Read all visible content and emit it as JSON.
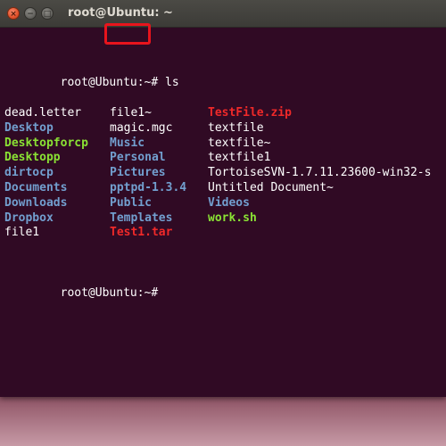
{
  "window": {
    "title": "root@Ubuntu: ~",
    "close_glyph": "×",
    "minimize_glyph": "−",
    "maximize_glyph": "□"
  },
  "colors": {
    "background": "#300a24",
    "text": "#ffffff",
    "directory": "#729fcf",
    "executable": "#8ae234",
    "archive": "#ef2929",
    "highlight_box": "#e8141c"
  },
  "terminal": {
    "prompt": "root@Ubuntu:~# ",
    "command": "ls",
    "final_prompt": "root@Ubuntu:~# ",
    "rows": [
      [
        {
          "text": "dead.letter",
          "type": "file"
        },
        {
          "text": "file1~",
          "type": "file"
        },
        {
          "text": "TestFile.zip",
          "type": "archive"
        }
      ],
      [
        {
          "text": "Desktop",
          "type": "directory"
        },
        {
          "text": "magic.mgc",
          "type": "file"
        },
        {
          "text": "textfile",
          "type": "file"
        }
      ],
      [
        {
          "text": "Desktopforcp",
          "type": "executable"
        },
        {
          "text": "Music",
          "type": "directory"
        },
        {
          "text": "textfile~",
          "type": "file"
        }
      ],
      [
        {
          "text": "Desktopp",
          "type": "executable"
        },
        {
          "text": "Personal",
          "type": "directory"
        },
        {
          "text": "textfile1",
          "type": "file"
        }
      ],
      [
        {
          "text": "dirtocp",
          "type": "directory"
        },
        {
          "text": "Pictures",
          "type": "directory"
        },
        {
          "text": "TortoiseSVN-1.7.11.23600-win32-s",
          "type": "file"
        }
      ],
      [
        {
          "text": "Documents",
          "type": "directory"
        },
        {
          "text": "pptpd-1.3.4",
          "type": "directory"
        },
        {
          "text": "Untitled Document~",
          "type": "file"
        }
      ],
      [
        {
          "text": "Downloads",
          "type": "directory"
        },
        {
          "text": "Public",
          "type": "directory"
        },
        {
          "text": "Videos",
          "type": "directory"
        }
      ],
      [
        {
          "text": "Dropbox",
          "type": "directory"
        },
        {
          "text": "Templates",
          "type": "directory"
        },
        {
          "text": "work.sh",
          "type": "executable"
        }
      ],
      [
        {
          "text": "file1",
          "type": "file"
        },
        {
          "text": "Test1.tar",
          "type": "archive"
        },
        {
          "text": "",
          "type": "file"
        }
      ]
    ]
  }
}
